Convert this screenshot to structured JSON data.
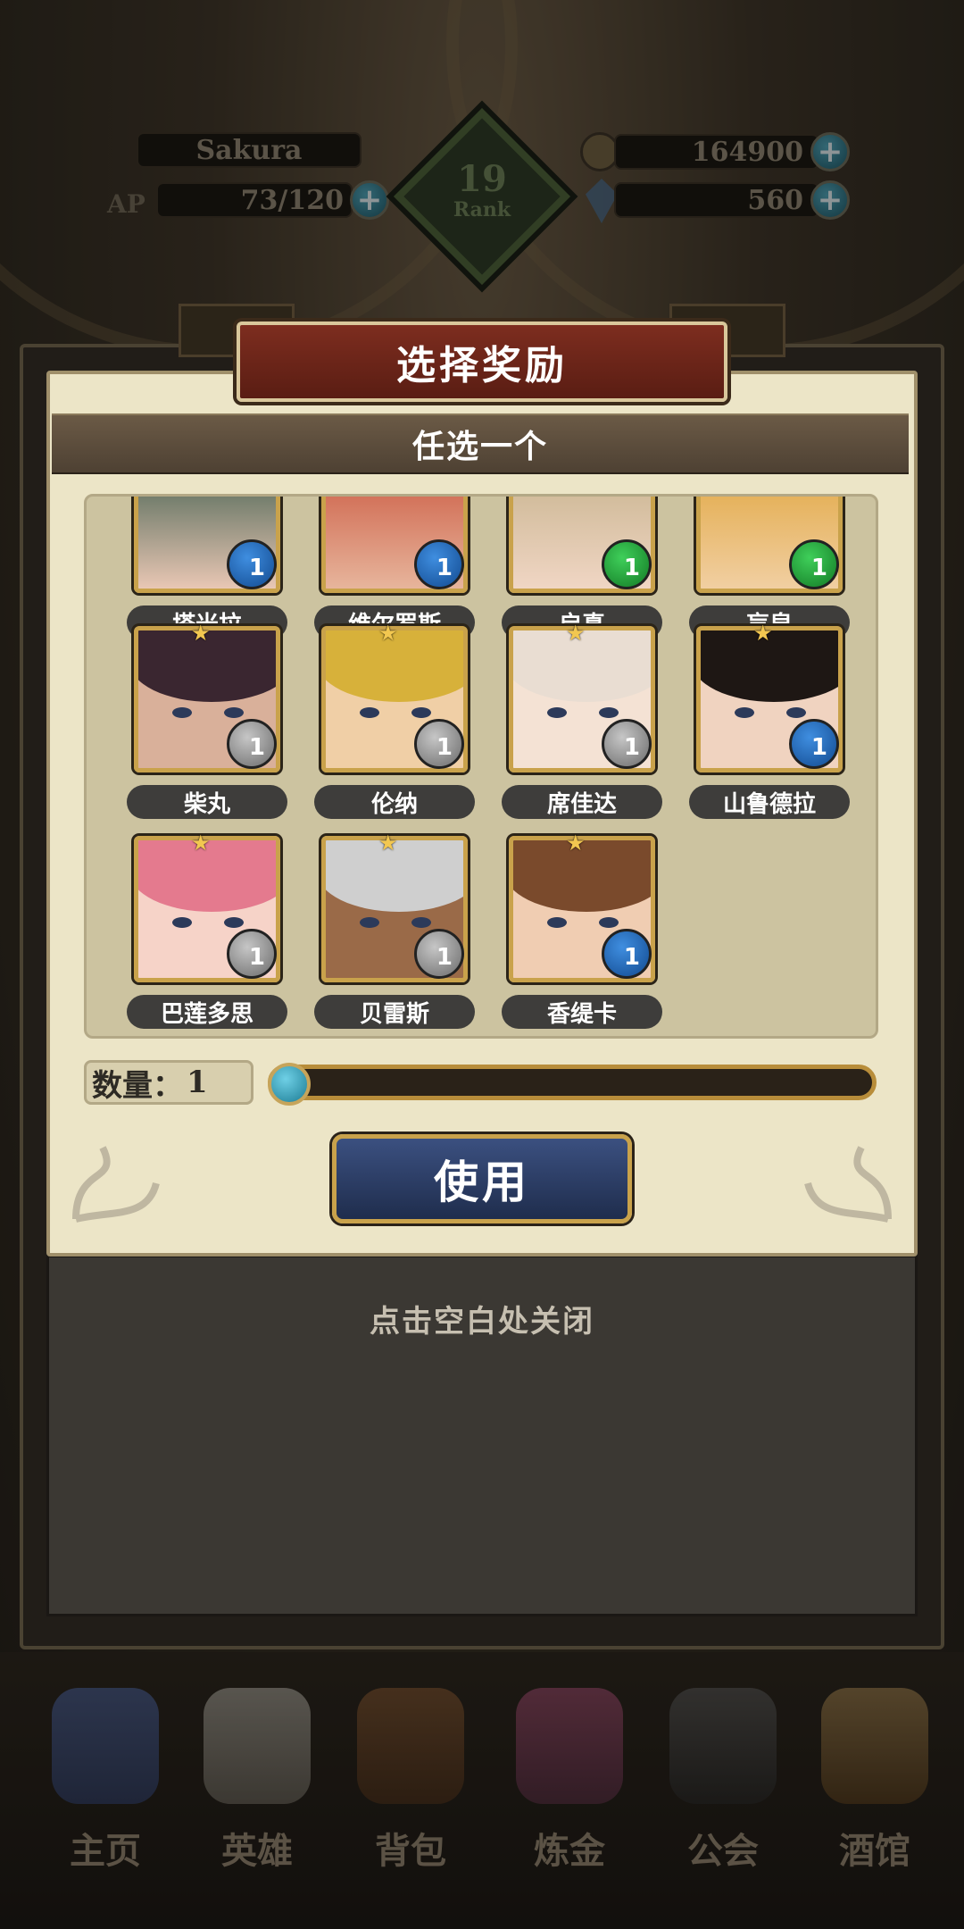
{
  "top_bar": {
    "player_name": "Sakura",
    "ap_label": "AP",
    "ap_value": "73/120",
    "rank_number": "19",
    "rank_label": "Rank",
    "gold": "164900",
    "crystals": "560"
  },
  "dialog": {
    "title": "选择奖励",
    "subtitle": "任选一个",
    "heroes": [
      {
        "name": "塔米拉",
        "badge": "1",
        "badge_color": "#2a74c8"
      },
      {
        "name": "维尔罗斯",
        "badge": "1",
        "badge_color": "#2a74c8"
      },
      {
        "name": "启真",
        "badge": "1",
        "badge_color": "#25a33a"
      },
      {
        "name": "盲泉",
        "badge": "1",
        "badge_color": "#25a33a"
      },
      {
        "name": "柴丸",
        "badge": "1",
        "badge_color": "#9a9a9a"
      },
      {
        "name": "伦纳",
        "badge": "1",
        "badge_color": "#9a9a9a"
      },
      {
        "name": "席佳达",
        "badge": "1",
        "badge_color": "#9a9a9a"
      },
      {
        "name": "山鲁德拉",
        "badge": "1",
        "badge_color": "#2a74c8"
      },
      {
        "name": "巴莲多思",
        "badge": "1",
        "badge_color": "#9a9a9a"
      },
      {
        "name": "贝雷斯",
        "badge": "1",
        "badge_color": "#9a9a9a"
      },
      {
        "name": "香缇卡",
        "badge": "1",
        "badge_color": "#2a74c8"
      }
    ],
    "quantity_label": "数量：",
    "quantity_value": "1",
    "use_button": "使用",
    "close_hint": "点击空白处关闭"
  },
  "bottom_nav": {
    "items": [
      {
        "label": "主页",
        "icon": "castle-icon"
      },
      {
        "label": "英雄",
        "icon": "winged-helmet-icon"
      },
      {
        "label": "背包",
        "icon": "backpack-icon"
      },
      {
        "label": "炼金",
        "icon": "potion-icon"
      },
      {
        "label": "公会",
        "icon": "guild-crest-icon"
      },
      {
        "label": "酒馆",
        "icon": "tavern-mug-icon"
      }
    ]
  },
  "colors": {
    "panel_bg": "#ece5c7",
    "title_banner": "#7d2d1f",
    "button_blue": "#2d3f66",
    "gold_trim": "#c9a24b"
  }
}
